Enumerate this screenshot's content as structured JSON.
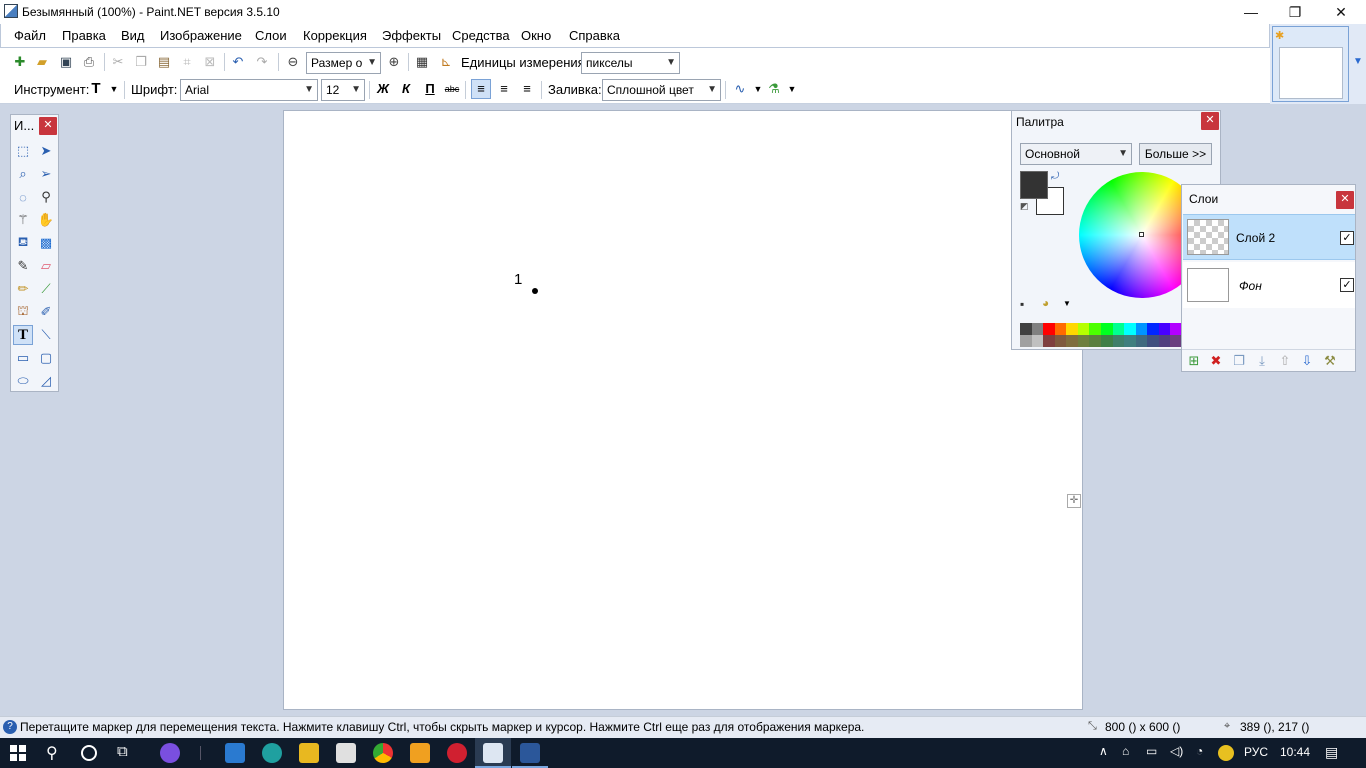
{
  "window": {
    "title": "Безымянный (100%) - Paint.NET версия 3.5.10",
    "minimize": "—",
    "restore": "❐",
    "close": "✕"
  },
  "menu": [
    "Файл",
    "Правка",
    "Вид",
    "Изображение",
    "Слои",
    "Коррекция",
    "Эффекты",
    "Средства",
    "Окно",
    "Справка"
  ],
  "toolbar1": {
    "zoom_value": "Размер о",
    "units_label": "Единицы измерения:",
    "units_value": "пикселы"
  },
  "toolbar2": {
    "tool_label": "Инструмент:",
    "font_label": "Шрифт:",
    "font_value": "Arial",
    "size_value": "12",
    "bold": "Ж",
    "italic": "К",
    "underline": "П",
    "strike": "abc",
    "fill_label": "Заливка:",
    "fill_value": "Сплошной цвет"
  },
  "tools_window": {
    "title": "И..."
  },
  "canvas": {
    "text": "1"
  },
  "palette": {
    "title": "Палитра",
    "mode": "Основной",
    "more_button": "Больше >>",
    "primary_color": "#333333",
    "secondary_color": "#ffffff"
  },
  "layers": {
    "title": "Слои",
    "items": [
      {
        "name": "Слой 2",
        "visible": true,
        "selected": true
      },
      {
        "name": "Фон",
        "visible": true,
        "selected": false
      }
    ]
  },
  "status": {
    "message": "Перетащите маркер для перемещения текста. Нажмите клавишу Ctrl, чтобы скрыть маркер и курсор. Нажмите Ctrl еще раз для отображения маркера.",
    "size": "800 () x 600 ()",
    "coords": "389 (), 217 ()"
  },
  "taskbar": {
    "lang": "РУС",
    "time": "10:44"
  }
}
